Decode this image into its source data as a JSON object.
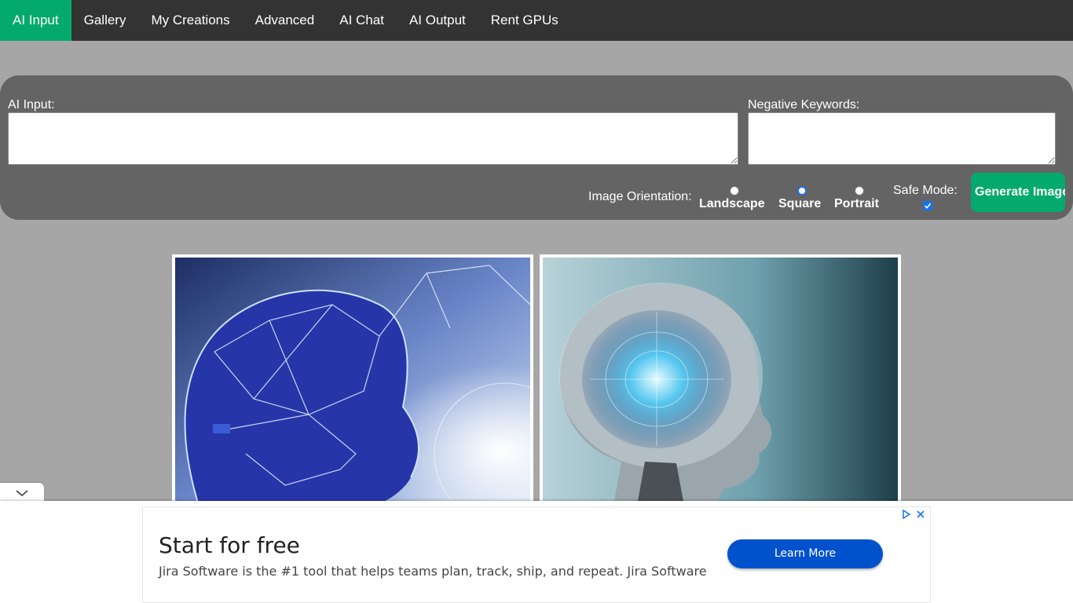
{
  "nav": {
    "items": [
      {
        "label": "AI Input",
        "active": true
      },
      {
        "label": "Gallery",
        "active": false
      },
      {
        "label": "My Creations",
        "active": false
      },
      {
        "label": "Advanced",
        "active": false
      },
      {
        "label": "AI Chat",
        "active": false
      },
      {
        "label": "AI Output",
        "active": false
      },
      {
        "label": "Rent GPUs",
        "active": false
      }
    ]
  },
  "form": {
    "ai_input_label": "AI Input:",
    "ai_input_value": "",
    "negative_label": "Negative Keywords:",
    "negative_value": "",
    "orientation_label": "Image Orientation:",
    "orientations": [
      {
        "label": "Landscape",
        "checked": false
      },
      {
        "label": "Square",
        "checked": true
      },
      {
        "label": "Portrait",
        "checked": false
      }
    ],
    "safe_mode_label": "Safe Mode:",
    "safe_mode_checked": true,
    "generate_label": "Generate Image"
  },
  "gallery": {
    "images": [
      {
        "icon": "ai-head-network-image"
      },
      {
        "icon": "ai-brain-circuit-image"
      }
    ]
  },
  "ad": {
    "title": "Start for free",
    "description": "Jira Software is the #1 tool that helps teams plan, track, ship, and repeat. Jira Software",
    "button_label": "Learn More"
  },
  "colors": {
    "accent": "#04aa6d",
    "nav_bg": "#333333",
    "page_bg": "#a6a6a6",
    "panel_bg": "#646464",
    "ad_button": "#0052cc"
  }
}
